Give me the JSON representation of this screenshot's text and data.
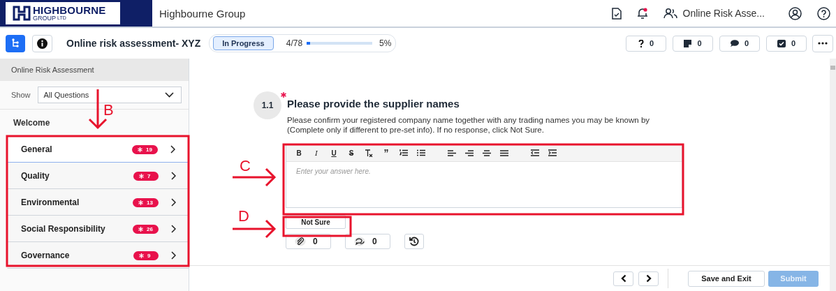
{
  "header": {
    "logo": {
      "name": "HIGHBOURNE",
      "sub": "GROUP",
      "suffix": "LTD"
    },
    "title": "Highbourne Group",
    "notification": true,
    "user_label": "Online Risk Asse..."
  },
  "toolbar": {
    "title": "Online risk assessment- XYZ",
    "status": "In Progress",
    "progress_text": "4/78",
    "level": 0.05,
    "percent": "5%",
    "counters": [
      {
        "kind": "question",
        "count": "0"
      },
      {
        "kind": "note",
        "count": "0"
      },
      {
        "kind": "comment",
        "count": "0"
      },
      {
        "kind": "task",
        "count": "0"
      }
    ]
  },
  "sidebar": {
    "title": "Online Risk Assessment",
    "show_label": "Show",
    "filter": "All Questions",
    "welcome": "Welcome",
    "items": [
      {
        "label": "General",
        "count": "19",
        "selected": true
      },
      {
        "label": "Quality",
        "count": "7",
        "selected": false
      },
      {
        "label": "Environmental",
        "count": "13",
        "selected": false
      },
      {
        "label": "Social Responsibility",
        "count": "26",
        "selected": false
      },
      {
        "label": "Governance",
        "count": "9",
        "selected": false
      }
    ]
  },
  "question": {
    "number": "1.1",
    "required": true,
    "title": "Please provide the supplier names",
    "description": "Please confirm your registered company name together with any trading names you may be known by (Complete only if different to pre-set info). If no response, click Not Sure.",
    "format_tools": [
      {
        "kind": "bold",
        "glyph": "B"
      },
      {
        "kind": "italic",
        "glyph": "I"
      },
      {
        "kind": "underline",
        "glyph": "U"
      },
      {
        "kind": "strike",
        "glyph": "S"
      },
      {
        "kind": "clear"
      },
      {
        "kind": "quote",
        "glyph": "”"
      },
      {
        "kind": "ordered"
      },
      {
        "kind": "bullets"
      },
      {
        "kind": "gap"
      },
      {
        "kind": "align-left"
      },
      {
        "kind": "align-right"
      },
      {
        "kind": "align-center"
      },
      {
        "kind": "justify"
      },
      {
        "kind": "gap"
      },
      {
        "kind": "outdent"
      },
      {
        "kind": "indent"
      }
    ],
    "placeholder": "Enter your answer here.",
    "not_sure": "Not Sure",
    "attachments": "0",
    "comments": "0"
  },
  "footer": {
    "save": "Save and Exit",
    "submit": "Submit",
    "submit_disabled": true
  },
  "annotations": [
    {
      "label": "B",
      "kind": "down"
    },
    {
      "label": "C",
      "kind": "right"
    },
    {
      "label": "D",
      "kind": "right"
    }
  ]
}
